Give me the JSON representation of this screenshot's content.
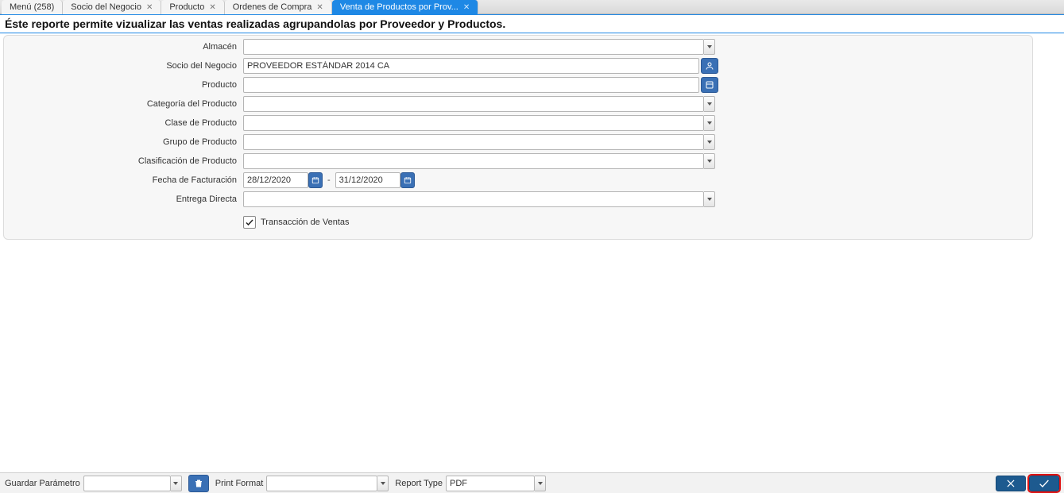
{
  "tabs": [
    {
      "label": "Menú (258)",
      "closable": false
    },
    {
      "label": "Socio del Negocio",
      "closable": true
    },
    {
      "label": "Producto",
      "closable": true
    },
    {
      "label": "Ordenes de Compra",
      "closable": true
    },
    {
      "label": "Venta de Productos por Prov...",
      "closable": true,
      "active": true
    }
  ],
  "header": {
    "title": "Éste reporte permite vizualizar las ventas realizadas agrupandolas por Proveedor y Productos."
  },
  "form": {
    "almacen": {
      "label": "Almacén",
      "value": ""
    },
    "socio": {
      "label": "Socio del Negocio",
      "value": "PROVEEDOR ESTÁNDAR 2014 CA"
    },
    "producto": {
      "label": "Producto",
      "value": ""
    },
    "categoria": {
      "label": "Categoría del Producto",
      "value": ""
    },
    "clase": {
      "label": "Clase de Producto",
      "value": ""
    },
    "grupo": {
      "label": "Grupo de Producto",
      "value": ""
    },
    "clasif": {
      "label": "Clasificación de Producto",
      "value": ""
    },
    "fecha": {
      "label": "Fecha de Facturación",
      "from": "28/12/2020",
      "to": "31/12/2020"
    },
    "entrega": {
      "label": "Entrega Directa",
      "value": ""
    },
    "transaccion": {
      "label": "Transacción de Ventas",
      "checked": true
    }
  },
  "footer": {
    "guardar_param": {
      "label": "Guardar Parámetro",
      "value": ""
    },
    "print_format": {
      "label": "Print Format",
      "value": ""
    },
    "report_type": {
      "label": "Report Type",
      "value": "PDF"
    }
  }
}
